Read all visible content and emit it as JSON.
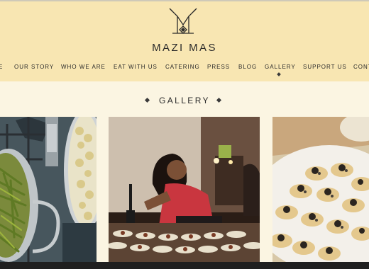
{
  "site": {
    "name": "MAZI MAS"
  },
  "nav": {
    "items": [
      {
        "label": "E",
        "active": false
      },
      {
        "label": "OUR STORY",
        "active": false
      },
      {
        "label": "WHO WE ARE",
        "active": false
      },
      {
        "label": "EAT WITH US",
        "active": false
      },
      {
        "label": "CATERING",
        "active": false
      },
      {
        "label": "PRESS",
        "active": false
      },
      {
        "label": "BLOG",
        "active": false
      },
      {
        "label": "GALLERY",
        "active": true
      },
      {
        "label": "SUPPORT US",
        "active": false
      },
      {
        "label": "CONT",
        "active": false
      }
    ]
  },
  "gallery": {
    "title": "GALLERY",
    "photos": [
      {
        "subject": "cooking pots with green beans and cauliflower"
      },
      {
        "subject": "cook plating dishes at a long table"
      },
      {
        "subject": "canapés on a white plate"
      }
    ]
  },
  "colors": {
    "header_bg": "#f8e6b2",
    "page_bg": "#fbf5e2",
    "text": "#2a2a2a"
  }
}
